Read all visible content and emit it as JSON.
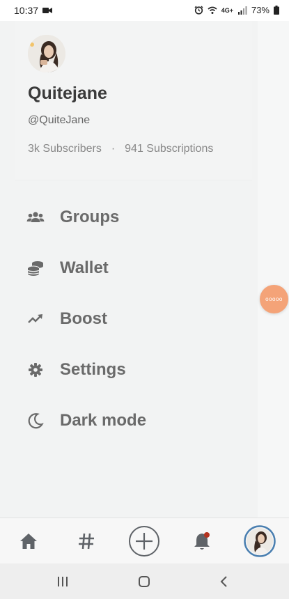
{
  "status_bar": {
    "time": "10:37",
    "network": "4G+",
    "battery": "73%"
  },
  "profile": {
    "display_name": "Quitejane",
    "handle": "@QuiteJane",
    "subscribers": "3k Subscribers",
    "separator": "·",
    "subscriptions": "941 Subscriptions"
  },
  "menu": {
    "items": [
      {
        "label": "Groups",
        "icon": "groups-icon"
      },
      {
        "label": "Wallet",
        "icon": "wallet-icon"
      },
      {
        "label": "Boost",
        "icon": "trending-up-icon"
      },
      {
        "label": "Settings",
        "icon": "gear-icon"
      },
      {
        "label": "Dark mode",
        "icon": "moon-icon"
      }
    ]
  },
  "floating_button": {
    "text": "ooooo"
  },
  "colors": {
    "accent_orange": "#f4a378",
    "avatar_ring": "#4a7fb0",
    "notification_dot": "#b3321f"
  },
  "bottom_nav": {
    "items": [
      "home-icon",
      "hashtag-icon",
      "add-circle-icon",
      "bell-icon",
      "profile-avatar"
    ]
  }
}
